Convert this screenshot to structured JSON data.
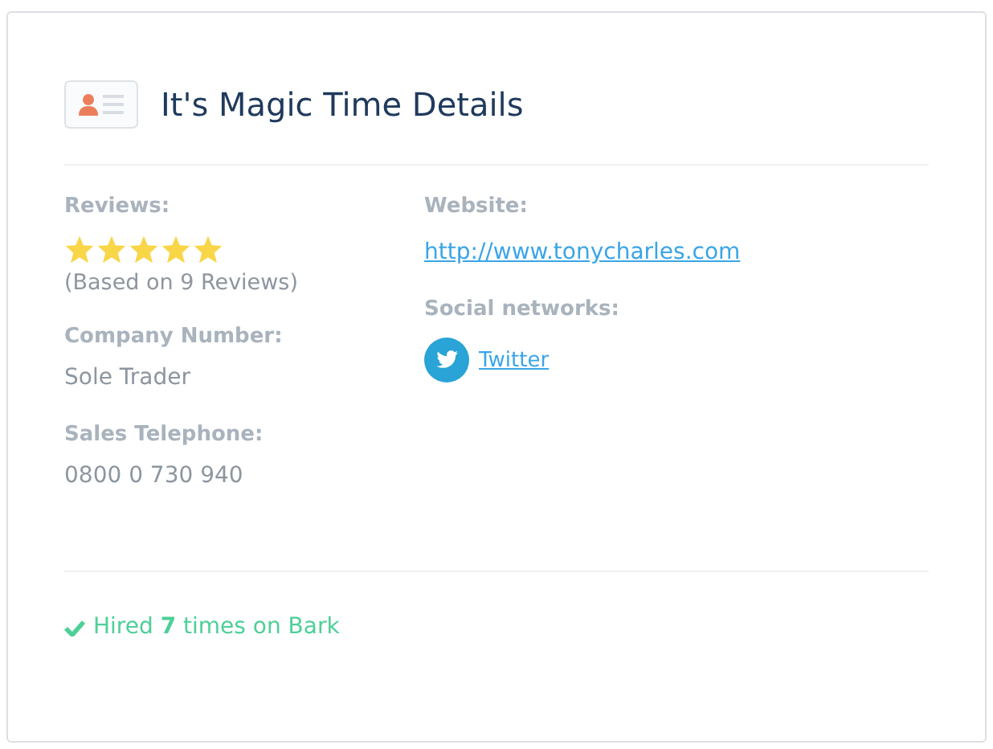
{
  "title": "It's Magic Time Details",
  "reviews": {
    "label": "Reviews:",
    "stars": 5,
    "note": "(Based on 9 Reviews)"
  },
  "left_fields": [
    {
      "label": "Company Number:",
      "value": "Sole Trader"
    },
    {
      "label": "Sales Telephone:",
      "value": "0800 0 730 940"
    }
  ],
  "website": {
    "label": "Website:",
    "link": "http://www.tonycharles.com"
  },
  "social": {
    "label": "Social networks:",
    "links": [
      {
        "kind": "twitter",
        "label": "Twitter"
      }
    ]
  },
  "footer": "Hired **7** times on Bark"
}
